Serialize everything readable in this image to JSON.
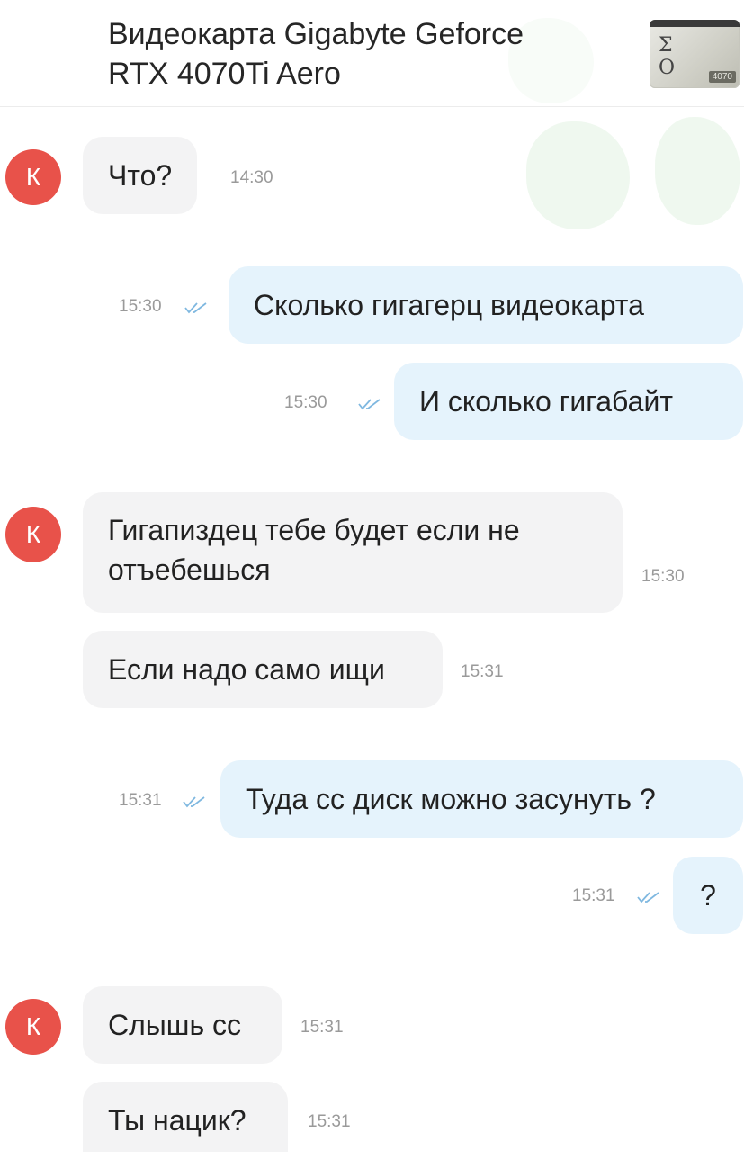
{
  "header": {
    "title": "Видеокарта Gigabyte Geforce\nRTX 4070Ti Aero",
    "thumb_text": "4070"
  },
  "colors": {
    "avatar": "#e8524a",
    "incoming_bubble": "#f3f3f4",
    "outgoing_bubble": "#e5f3fc",
    "read_checks": "#7fb8e0"
  },
  "messages": [
    {
      "direction": "in",
      "avatar": "К",
      "text": "Что?",
      "time": "14:30"
    },
    {
      "direction": "out",
      "text": "Сколько гигагерц видеокарта",
      "time": "15:30",
      "status": "read"
    },
    {
      "direction": "out",
      "text": "И сколько гигабайт",
      "time": "15:30",
      "status": "read"
    },
    {
      "direction": "in",
      "avatar": "К",
      "text": "Гигапиздец тебе будет если не\nотъебешься",
      "time": "15:30"
    },
    {
      "direction": "in",
      "text": "Если надо само ищи",
      "time": "15:31"
    },
    {
      "direction": "out",
      "text": "Туда сс диск можно засунуть ?",
      "time": "15:31",
      "status": "read"
    },
    {
      "direction": "out",
      "text": "?",
      "time": "15:31",
      "status": "read"
    },
    {
      "direction": "in",
      "avatar": "К",
      "text": "Слышь сс",
      "time": "15:31"
    },
    {
      "direction": "in",
      "text": "Ты нацик?",
      "time": "15:31"
    }
  ]
}
